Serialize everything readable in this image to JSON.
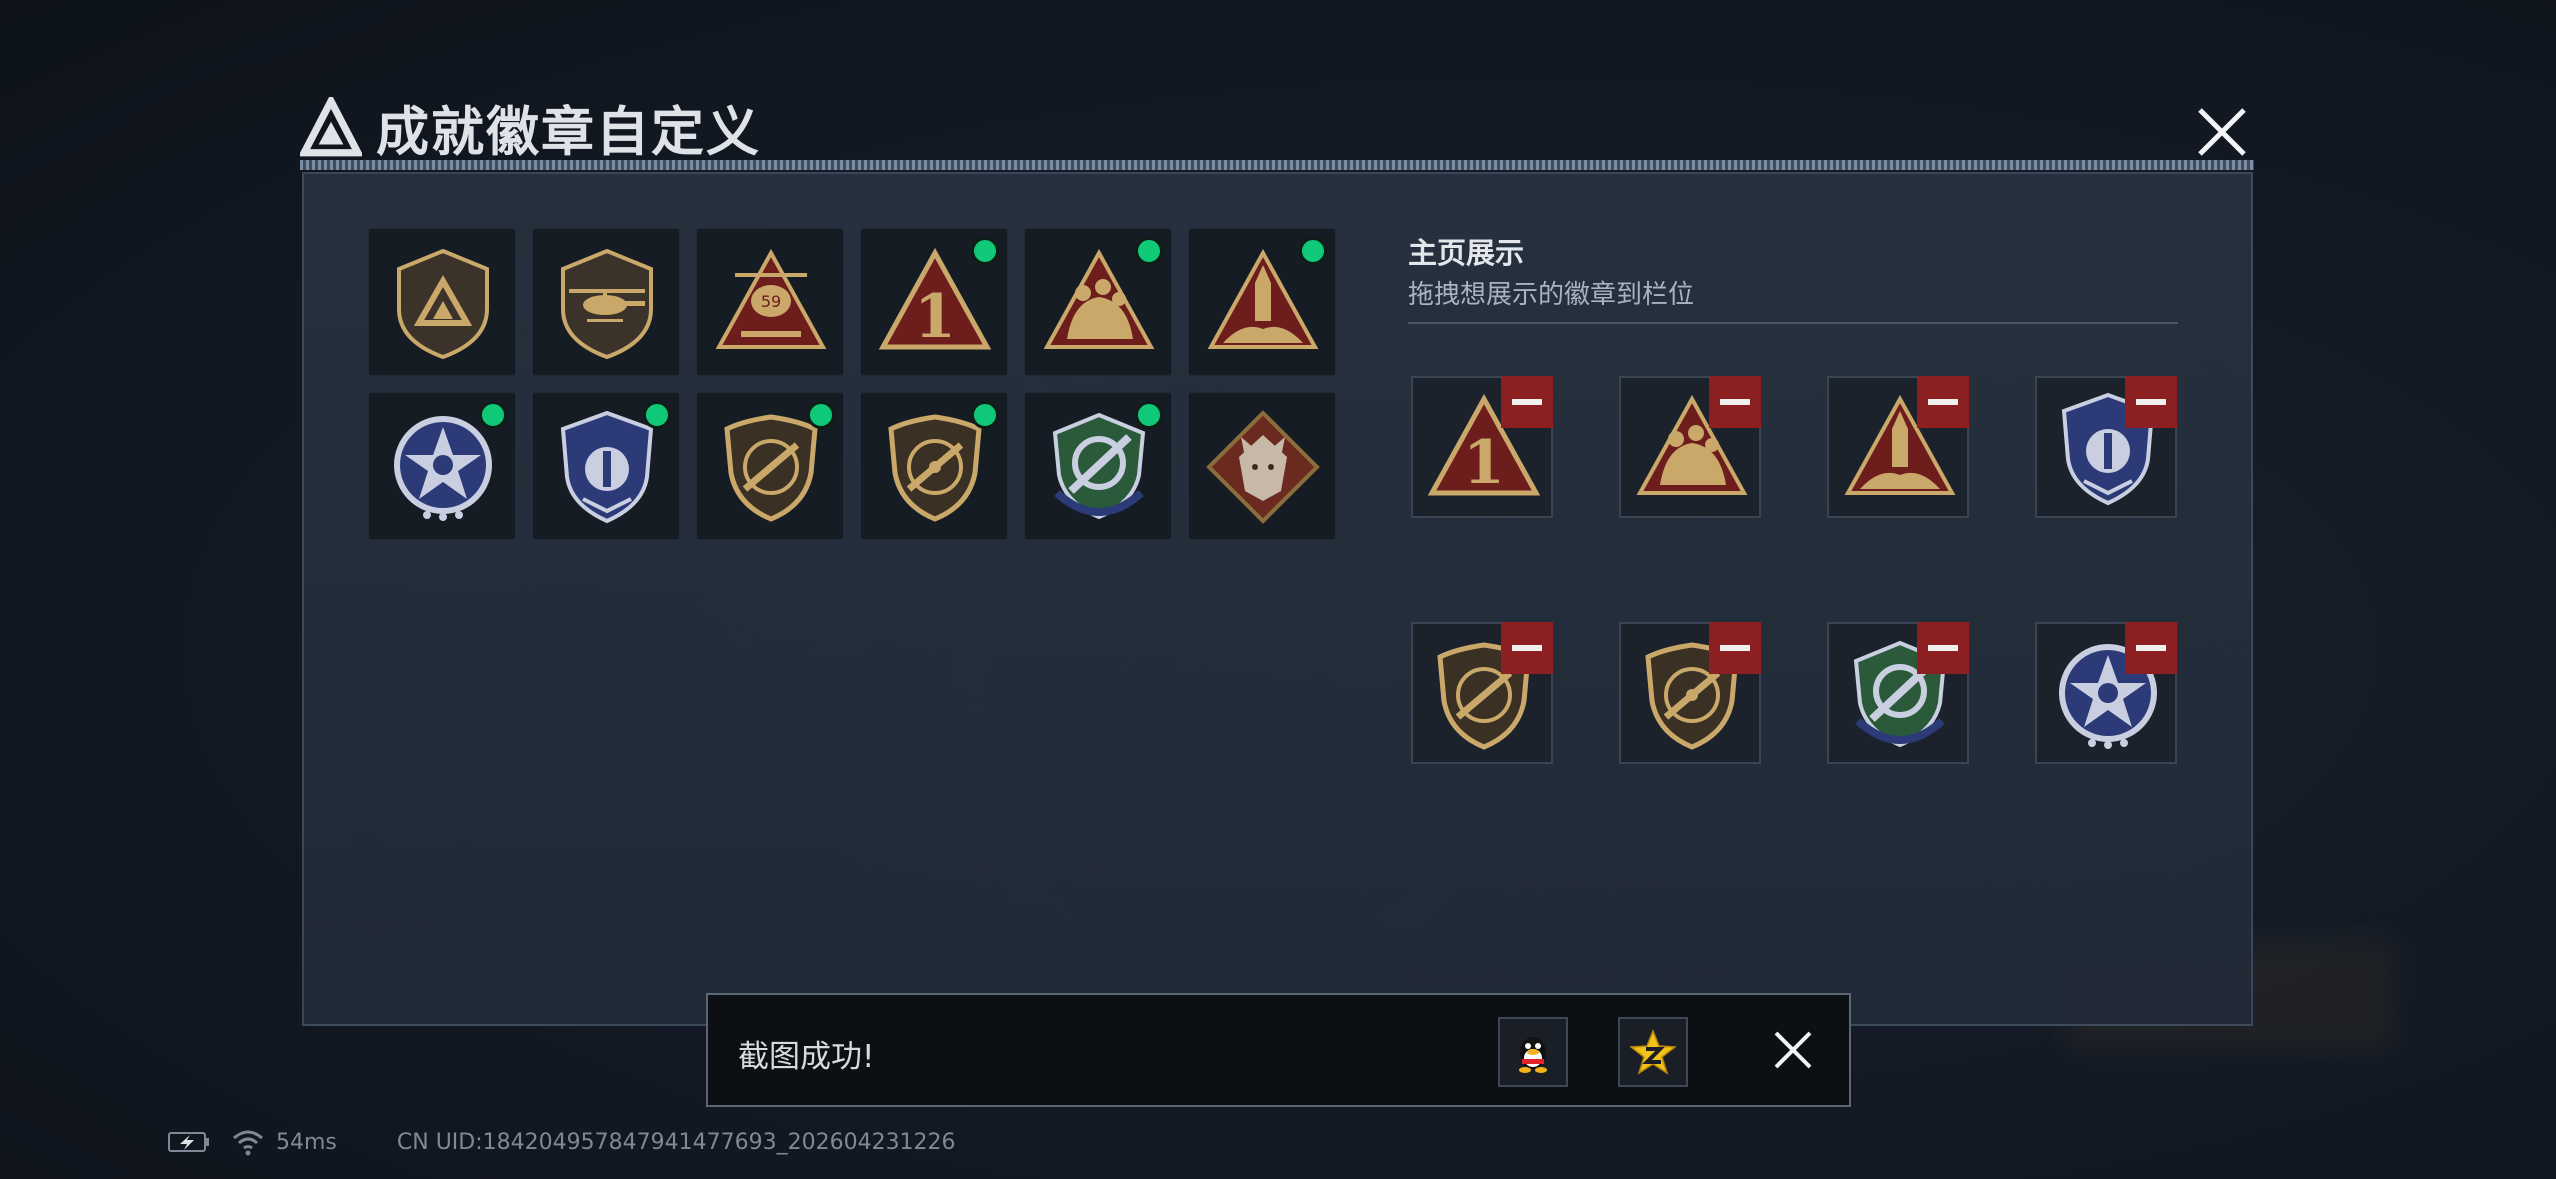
{
  "window": {
    "title": "成就徽章自定义"
  },
  "badges": [
    {
      "icon": "shield-logo-badge-icon",
      "new": false
    },
    {
      "icon": "helicopter-badge-icon",
      "new": false
    },
    {
      "icon": "helicopter-triangle-badge-icon",
      "new": false
    },
    {
      "icon": "number-one-triangle-badge-icon",
      "new": true
    },
    {
      "icon": "soldiers-triangle-badge-icon",
      "new": true
    },
    {
      "icon": "rocket-triangle-badge-icon",
      "new": true
    },
    {
      "icon": "star-circle-badge-icon",
      "new": true
    },
    {
      "icon": "blue-crest-badge-icon",
      "new": true
    },
    {
      "icon": "gold-rifle-shield-badge-icon",
      "new": true
    },
    {
      "icon": "gold-rifle-shield-2-badge-icon",
      "new": true
    },
    {
      "icon": "green-knife-crest-badge-icon",
      "new": true
    },
    {
      "icon": "wolf-diamond-badge-icon",
      "new": false
    }
  ],
  "showcase": {
    "title": "主页展示",
    "subtitle": "拖拽想展示的徽章到栏位",
    "slots": [
      {
        "icon": "number-one-triangle-badge-icon"
      },
      {
        "icon": "soldiers-triangle-badge-icon"
      },
      {
        "icon": "rocket-triangle-badge-icon"
      },
      {
        "icon": "blue-crest-badge-icon"
      },
      {
        "icon": "gold-rifle-shield-badge-icon"
      },
      {
        "icon": "gold-rifle-shield-2-badge-icon"
      },
      {
        "icon": "green-knife-crest-badge-icon"
      },
      {
        "icon": "star-circle-badge-icon"
      }
    ]
  },
  "toast": {
    "message": "截图成功!",
    "share_targets": [
      "qq-share-icon",
      "qzone-share-icon"
    ]
  },
  "status_bar": {
    "ping": "54ms",
    "uid": "CN UID:184204957847941477693_202604231226"
  },
  "colors": {
    "new_indicator": "#10c978",
    "remove_button": "#8b1f22"
  }
}
